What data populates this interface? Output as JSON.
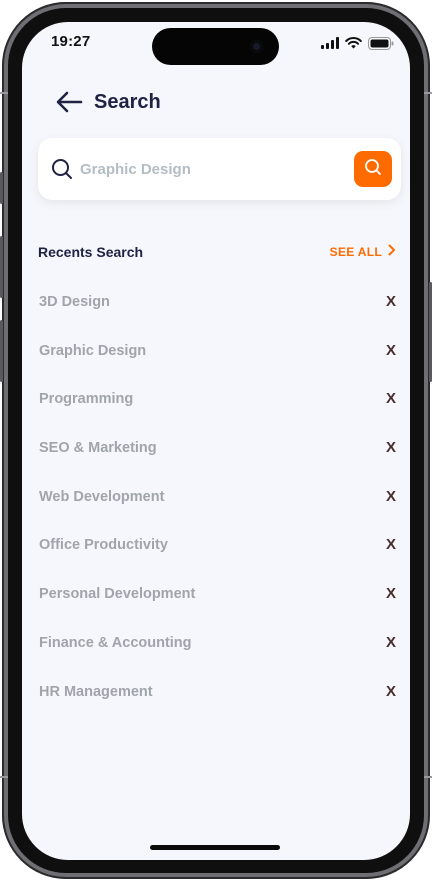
{
  "status_bar": {
    "time": "19:27"
  },
  "header": {
    "back_icon": "arrow-left-icon",
    "title": "Search"
  },
  "search": {
    "placeholder": "Graphic Design",
    "value": "",
    "icon": "search-icon",
    "button_icon": "search-icon"
  },
  "recents": {
    "title": "Recents Search",
    "see_all_label": "SEE ALL",
    "items": [
      {
        "label": "3D Design",
        "remove": "X"
      },
      {
        "label": "Graphic Design",
        "remove": "X"
      },
      {
        "label": "Programming",
        "remove": "X"
      },
      {
        "label": "SEO & Marketing",
        "remove": "X"
      },
      {
        "label": "Web Development",
        "remove": "X"
      },
      {
        "label": "Office Productivity",
        "remove": "X"
      },
      {
        "label": "Personal Development",
        "remove": "X"
      },
      {
        "label": "Finance & Accounting",
        "remove": "X"
      },
      {
        "label": "HR Management",
        "remove": "X"
      }
    ]
  },
  "colors": {
    "accent": "#FF6B00",
    "heading": "#202244",
    "muted_text": "#A0A4AB",
    "background": "#F6F7FC",
    "remove_icon": "#472D2D"
  }
}
